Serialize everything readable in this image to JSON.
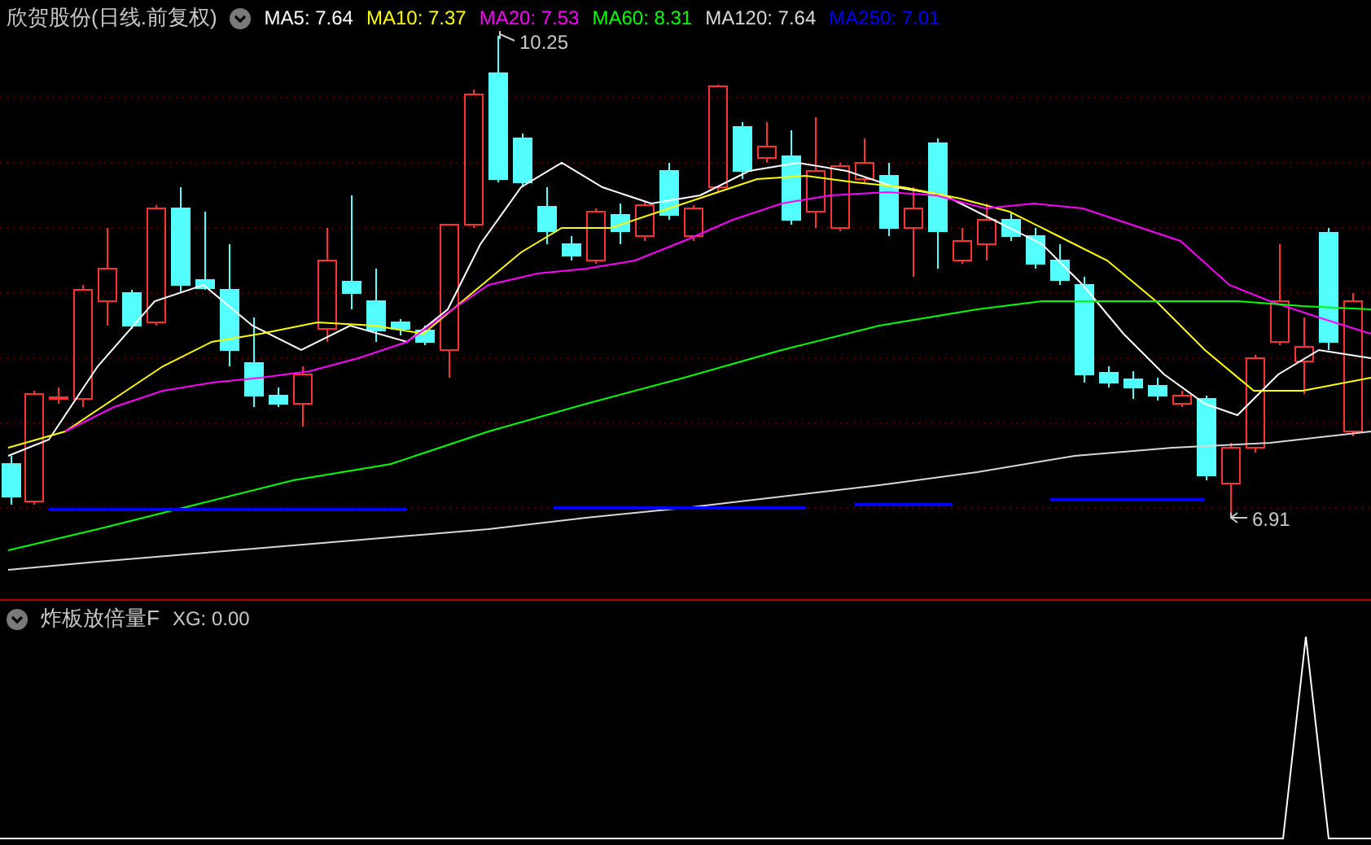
{
  "main_panel": {
    "title": "欣贺股份(日线.前复权)",
    "indicators": [
      {
        "label": "MA5: 7.64",
        "color": "#ffffff"
      },
      {
        "label": "MA10: 7.37",
        "color": "#ffff00"
      },
      {
        "label": "MA20: 7.53",
        "color": "#ff00ff"
      },
      {
        "label": "MA60: 8.31",
        "color": "#00ff00"
      },
      {
        "label": "MA120: 7.64",
        "color": "#d8d8d8"
      },
      {
        "label": "MA250: 7.01",
        "color": "#0000ff"
      }
    ],
    "high_label": "10.25",
    "low_label": "6.91"
  },
  "sub_panel": {
    "title": "炸板放倍量F",
    "reading": "XG: 0.00"
  }
}
